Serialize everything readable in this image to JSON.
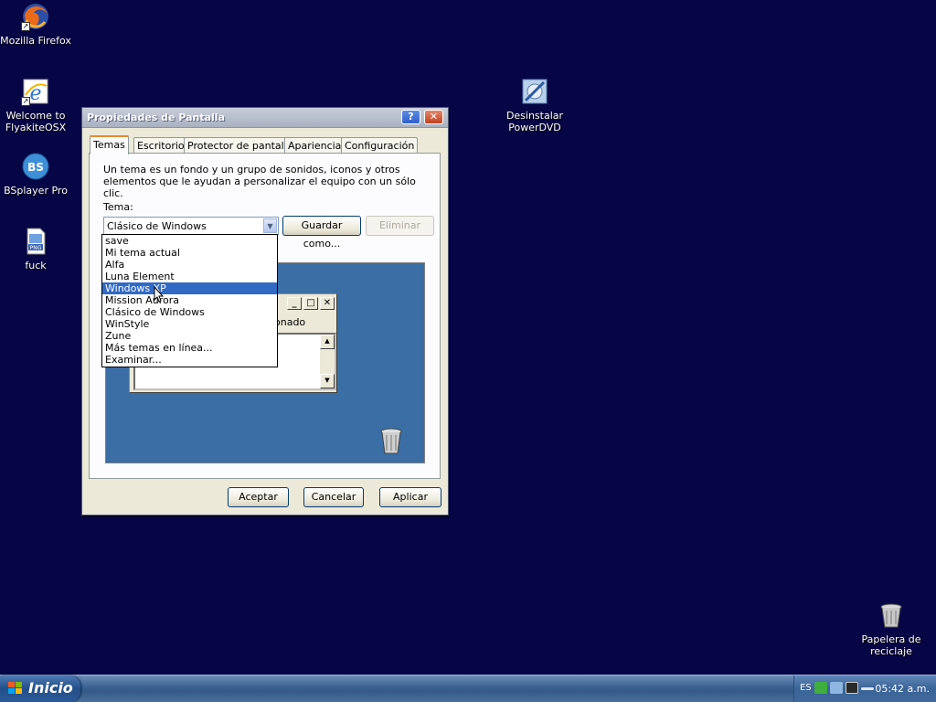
{
  "desktop": {
    "icons": [
      {
        "label": "Mozilla Firefox"
      },
      {
        "label": "Welcome to FlyakiteOSX"
      },
      {
        "label": "BSplayer Pro"
      },
      {
        "label": "fuck"
      },
      {
        "label": "Desinstalar PowerDVD"
      },
      {
        "label": "Papelera de reciclaje"
      }
    ],
    "png_badge": "PNG",
    "bs_badge": "BS"
  },
  "dialog": {
    "title": "Propiedades de Pantalla",
    "help_glyph": "?",
    "close_glyph": "✕",
    "tabs": [
      "Temas",
      "Escritorio",
      "Protector de pantalla",
      "Apariencia",
      "Configuración"
    ],
    "description": "Un tema es un fondo y un grupo de sonidos, iconos y otros elementos que le ayudan a personalizar el equipo con un sólo clic.",
    "tema_label": "Tema:",
    "combo_value": "Clásico de Windows",
    "save_button": "Guardar como...",
    "delete_button": "Eliminar",
    "ok_button": "Aceptar",
    "cancel_button": "Cancelar",
    "apply_button": "Aplicar",
    "preview_partial_text": "onado",
    "dropdown": {
      "items": [
        "save",
        "Mi tema actual",
        "Alfa",
        "Luna Element",
        "Windows XP",
        "Mission Aurora",
        "Clásico de Windows",
        "WinStyle",
        "Zune",
        "Más temas en línea...",
        "Examinar..."
      ],
      "selected": "Windows XP"
    }
  },
  "taskbar": {
    "start_label": "Inicio",
    "language": "ES",
    "clock": "05:42 a.m."
  },
  "colors": {
    "desktop_bg": "#060546",
    "preview_bg": "#3a6ea5",
    "selection": "#316ac5"
  }
}
